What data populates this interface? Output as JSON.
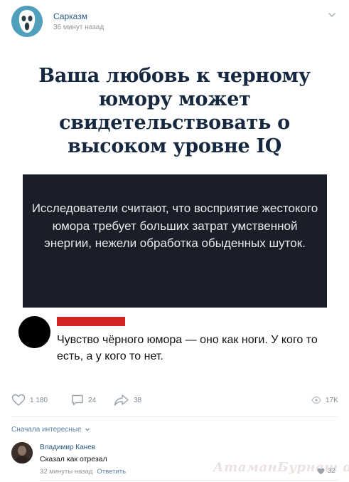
{
  "post": {
    "group_name": "Сарказм",
    "time": "36 минут назад",
    "avatar_icon": "scream-face-icon",
    "menu_icon": "chevron-down-icon"
  },
  "image": {
    "headline": "Ваша любовь к черному юмору может свидетельствовать о высоком уровне IQ",
    "box_text": "Исследователи считают, что восприятие жестокого юмора требует больших затрат умственной энергии, нежели обработка обыденных шуток.",
    "quote": "Чувство чёрного юмора — оно как ноги. У кого то есть, а у кого то нет.",
    "headline_color": "#15283f",
    "box_color": "#1a1e29",
    "bar_color": "#d52424"
  },
  "actions": {
    "likes": "1 180",
    "comments": "24",
    "shares": "38",
    "views": "17K"
  },
  "comments": {
    "sort_label": "Сначала интересные",
    "items": [
      {
        "author": "Владимир Канев",
        "text": "Сказал как отрезал",
        "time": "32 минуты назад",
        "reply": "Ответить",
        "likes": "32"
      }
    ]
  },
  "watermark": "АтаманБурнаш dmi.ru"
}
